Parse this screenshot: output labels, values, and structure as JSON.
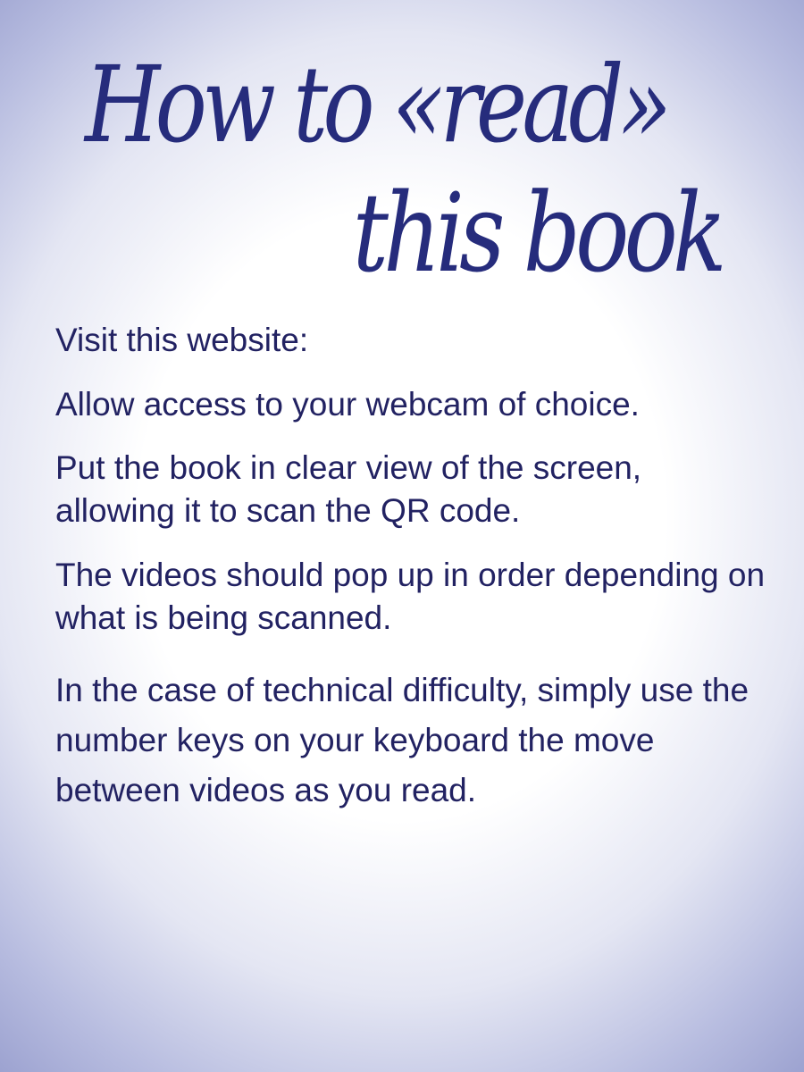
{
  "title": {
    "line1": "How to «read»",
    "line2": "this book"
  },
  "instructions": {
    "visit": "Visit this website:",
    "webcam": "Allow access to your webcam of choice.",
    "put_book": "Put the book in clear view of the screen, allowing it to scan the QR code.",
    "videos": "The videos should pop up in order depending on what is being scanned.",
    "difficulty": "In the case of technical difficulty, simply use the number keys on your keyboard the move between videos as you read."
  },
  "colors": {
    "title": "#262c7c",
    "body_text": "#222262",
    "vignette_edge": "#9ca2d0"
  }
}
